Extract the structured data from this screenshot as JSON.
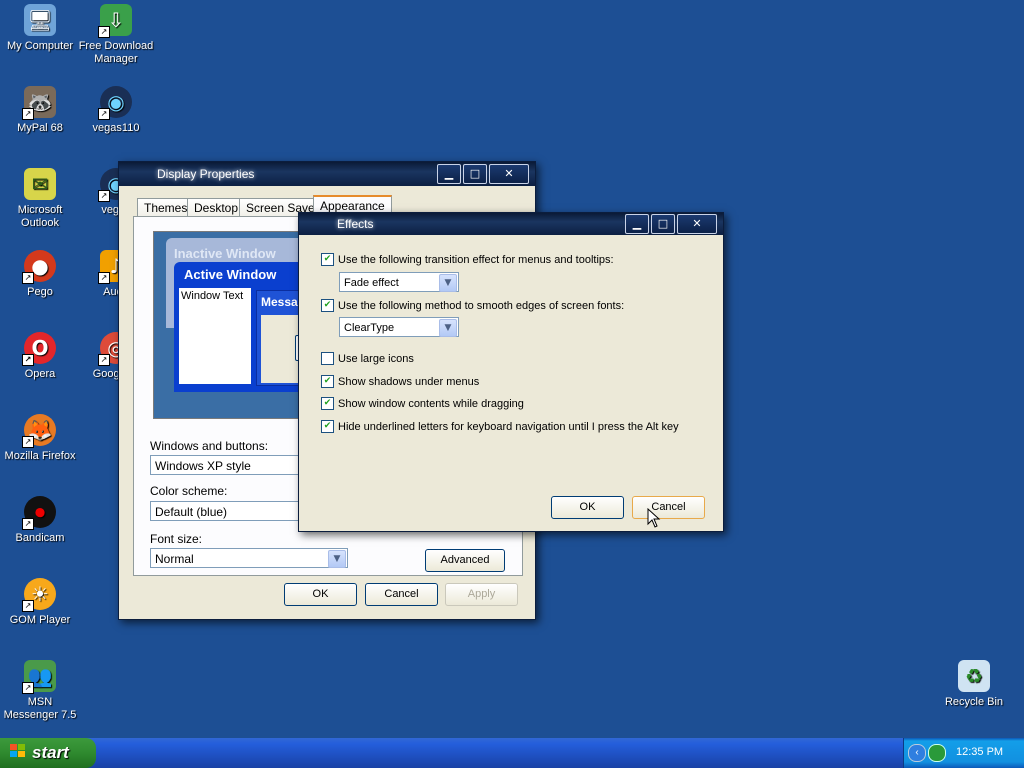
{
  "desktop": {
    "icons_left": [
      {
        "label": "My Computer",
        "icon": "computer-icon",
        "glyph": "🖥"
      },
      {
        "label": "MyPal 68",
        "icon": "raccoon-icon",
        "glyph": "🦝"
      },
      {
        "label": "Microsoft Outlook",
        "icon": "outlook-icon",
        "glyph": "✉"
      },
      {
        "label": "Pego",
        "icon": "pego-icon",
        "glyph": "●"
      },
      {
        "label": "Opera",
        "icon": "opera-icon",
        "glyph": "O"
      },
      {
        "label": "Mozilla Firefox",
        "icon": "firefox-icon",
        "glyph": "🦊"
      },
      {
        "label": "Bandicam",
        "icon": "bandicam-icon",
        "glyph": "⏺"
      },
      {
        "label": "GOM Player",
        "icon": "gom-player-icon",
        "glyph": "☀"
      },
      {
        "label": "MSN Messenger 7.5",
        "icon": "msn-icon",
        "glyph": "👥"
      }
    ],
    "icons_right": [
      {
        "label": "Free Download Manager",
        "icon": "download-manager-icon",
        "glyph": "⇩"
      },
      {
        "label": "vegas110",
        "icon": "vegas-icon",
        "glyph": "◉"
      },
      {
        "label": "vegas",
        "icon": "vegas-icon",
        "glyph": "◉"
      },
      {
        "label": "Auda",
        "icon": "audacity-icon",
        "glyph": "♪"
      },
      {
        "label": "Google C",
        "icon": "chrome-icon",
        "glyph": "◎"
      }
    ],
    "recycle_bin": {
      "label": "Recycle Bin",
      "icon": "recycle-bin-icon",
      "glyph": "♻"
    }
  },
  "display_properties": {
    "title": "Display Properties",
    "tabs": [
      "Themes",
      "Desktop",
      "Screen Saver",
      "Appearance"
    ],
    "preview": {
      "inactive_window": "Inactive Window",
      "active_window": "Active Window",
      "window_text": "Window Text",
      "message_box": "Messag"
    },
    "windows_and_buttons_label": "Windows and buttons:",
    "windows_and_buttons_value": "Windows XP style",
    "color_scheme_label": "Color scheme:",
    "color_scheme_value": "Default (blue)",
    "font_size_label": "Font size:",
    "font_size_value": "Normal",
    "advanced_button": "Advanced",
    "ok_button": "OK",
    "cancel_button": "Cancel",
    "apply_button": "Apply"
  },
  "effects": {
    "title": "Effects",
    "transition_label": "Use the following transition effect for menus and tooltips:",
    "transition_checked": true,
    "transition_value": "Fade effect",
    "smooth_label": "Use the following method to smooth edges of screen fonts:",
    "smooth_checked": true,
    "smooth_value": "ClearType",
    "large_icons_label": "Use large icons",
    "large_icons_checked": false,
    "shadows_label": "Show shadows under menus",
    "shadows_checked": true,
    "drag_label": "Show window contents while dragging",
    "drag_checked": true,
    "hide_underline_label": "Hide underlined letters for keyboard navigation until I press the Alt key",
    "hide_underline_checked": true,
    "ok_button": "OK",
    "cancel_button": "Cancel"
  },
  "taskbar": {
    "start_label": "start",
    "clock": "12:35 PM"
  },
  "colors": {
    "desktop": "#1d4f94",
    "start_green": "#2f8a2f",
    "taskbar_blue": "#245edb",
    "checkmark": "#21a121"
  }
}
